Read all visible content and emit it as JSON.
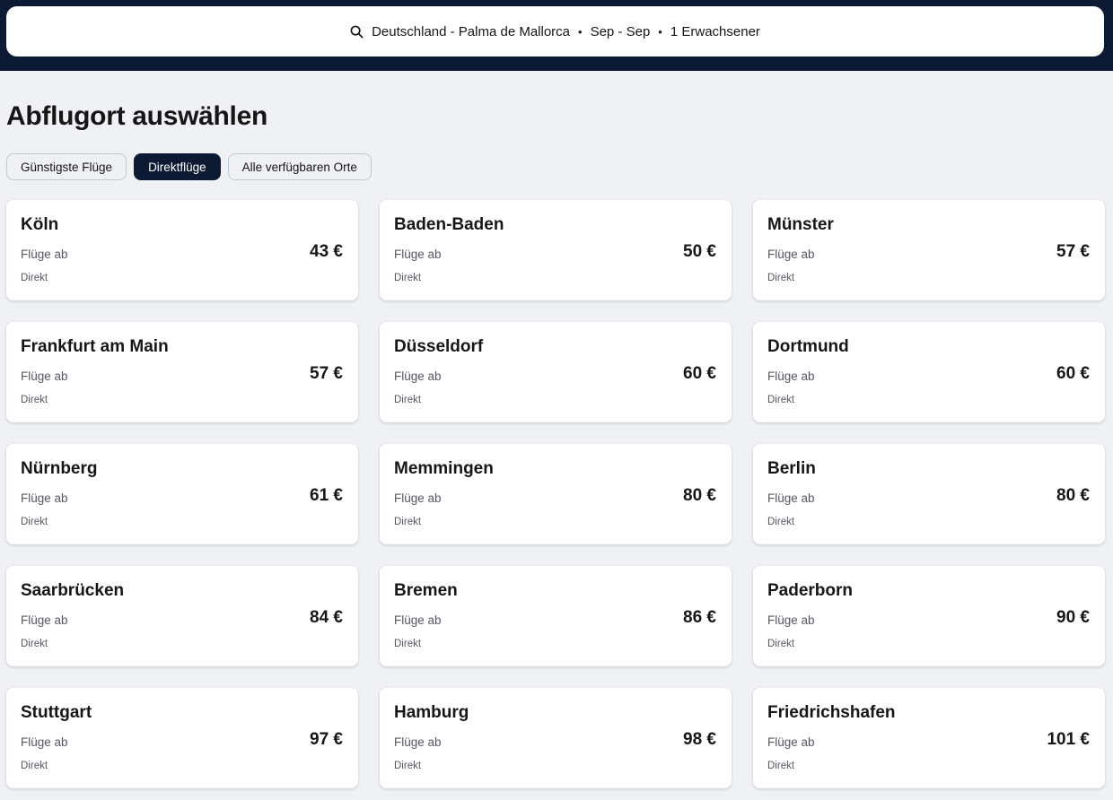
{
  "search": {
    "route": "Deutschland - Palma de Mallorca",
    "dates": "Sep - Sep",
    "travellers": "1 Erwachsener",
    "separator": "•"
  },
  "page_title": "Abflugort auswählen",
  "filters": [
    "Günstigste Flüge",
    "Direktflüge",
    "Alle verfügbaren Orte"
  ],
  "active_filter": "Direktflüge",
  "cards": [
    {
      "city": "Köln",
      "from_label": "Flüge ab",
      "price": "43 €",
      "type": "Direkt"
    },
    {
      "city": "Baden-Baden",
      "from_label": "Flüge ab",
      "price": "50 €",
      "type": "Direkt"
    },
    {
      "city": "Münster",
      "from_label": "Flüge ab",
      "price": "57 €",
      "type": "Direkt"
    },
    {
      "city": "Frankfurt am Main",
      "from_label": "Flüge ab",
      "price": "57 €",
      "type": "Direkt"
    },
    {
      "city": "Düsseldorf",
      "from_label": "Flüge ab",
      "price": "60 €",
      "type": "Direkt"
    },
    {
      "city": "Dortmund",
      "from_label": "Flüge ab",
      "price": "60 €",
      "type": "Direkt"
    },
    {
      "city": "Nürnberg",
      "from_label": "Flüge ab",
      "price": "61 €",
      "type": "Direkt"
    },
    {
      "city": "Memmingen",
      "from_label": "Flüge ab",
      "price": "80 €",
      "type": "Direkt"
    },
    {
      "city": "Berlin",
      "from_label": "Flüge ab",
      "price": "80 €",
      "type": "Direkt"
    },
    {
      "city": "Saarbrücken",
      "from_label": "Flüge ab",
      "price": "84 €",
      "type": "Direkt"
    },
    {
      "city": "Bremen",
      "from_label": "Flüge ab",
      "price": "86 €",
      "type": "Direkt"
    },
    {
      "city": "Paderborn",
      "from_label": "Flüge ab",
      "price": "90 €",
      "type": "Direkt"
    },
    {
      "city": "Stuttgart",
      "from_label": "Flüge ab",
      "price": "97 €",
      "type": "Direkt"
    },
    {
      "city": "Hamburg",
      "from_label": "Flüge ab",
      "price": "98 €",
      "type": "Direkt"
    },
    {
      "city": "Friedrichshafen",
      "from_label": "Flüge ab",
      "price": "101 €",
      "type": "Direkt"
    }
  ],
  "colors": {
    "header_bg": "#0c1b33",
    "page_bg": "#eff1f5",
    "active_chip": "#0c1b33"
  },
  "icons": {
    "search": "search-icon"
  }
}
